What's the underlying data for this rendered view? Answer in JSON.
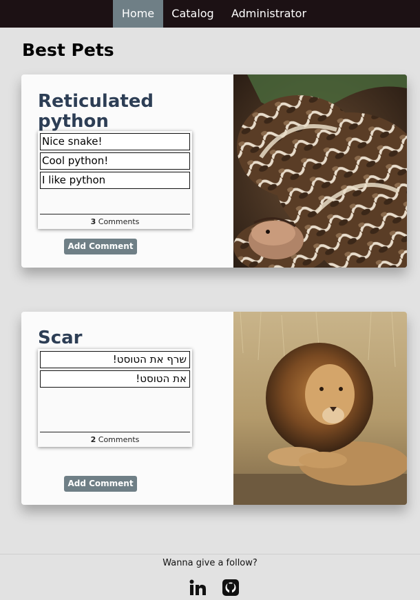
{
  "nav": {
    "items": [
      {
        "label": "Home",
        "active": true
      },
      {
        "label": "Catalog",
        "active": false
      },
      {
        "label": "Administrator",
        "active": false
      }
    ],
    "background": "#1c1114",
    "active_color": "#6f7f86"
  },
  "page": {
    "title": "Best Pets"
  },
  "cards": [
    {
      "name": "Reticulated python",
      "comments": [
        "Nice snake!",
        "Cool python!",
        "I like python"
      ],
      "comment_count": "3",
      "comments_label": "Comments",
      "add_label": "Add Comment",
      "image": "python-photo"
    },
    {
      "name": "Scar",
      "comments": [
        "שרף את הטוסט!",
        "את הטוסט!"
      ],
      "comment_count": "2",
      "comments_label": "Comments",
      "add_label": "Add Comment",
      "image": "lion-photo"
    }
  ],
  "footer": {
    "text": "Wanna give a follow?",
    "icons": [
      "linkedin-icon",
      "github-icon"
    ]
  },
  "colors": {
    "title": "#2d3e55",
    "button": "#6f7f86",
    "page_bg": "#e2e2e2"
  }
}
